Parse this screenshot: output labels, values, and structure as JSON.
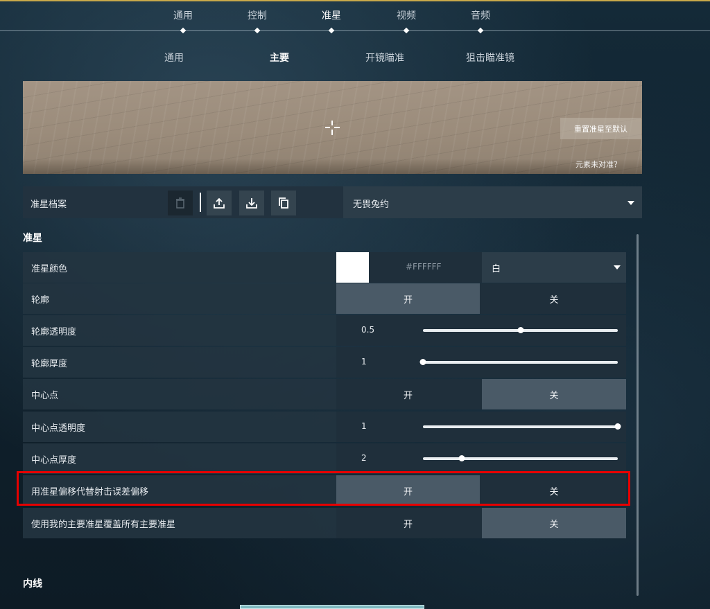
{
  "nav": {
    "tabs": [
      "通用",
      "控制",
      "准星",
      "视频",
      "音频"
    ],
    "active_tab": "准星",
    "subtabs": [
      "通用",
      "主要",
      "开镜瞄准",
      "狙击瞄准镜"
    ],
    "active_subtab": "主要"
  },
  "preview": {
    "reset_label": "重置准星至默认",
    "misaligned_label": "元素未对准？"
  },
  "profile": {
    "label": "准星档案",
    "selected": "无畏兔约",
    "icons": [
      "trash-icon",
      "upload-icon",
      "download-icon",
      "copy-icon"
    ]
  },
  "section_title": "准星",
  "settings": {
    "color": {
      "label": "准星颜色",
      "hex": "#FFFFFF",
      "name": "白",
      "swatch": "#FFFFFF"
    },
    "outline": {
      "label": "轮廓",
      "on": "开",
      "off": "关",
      "selected": "on"
    },
    "outline_opacity": {
      "label": "轮廓透明度",
      "value": "0.5",
      "fraction": 0.5
    },
    "outline_thickness": {
      "label": "轮廓厚度",
      "value": "1",
      "fraction": 0.0
    },
    "center_dot": {
      "label": "中心点",
      "on": "开",
      "off": "关",
      "selected": "off"
    },
    "center_dot_opacity": {
      "label": "中心点透明度",
      "value": "1",
      "fraction": 1.0
    },
    "center_dot_thickness": {
      "label": "中心点厚度",
      "value": "2",
      "fraction": 0.2
    },
    "firing_error_offset": {
      "label": "用准星偏移代替射击误差偏移",
      "on": "开",
      "off": "关",
      "selected": "on"
    },
    "override_primary": {
      "label": "使用我的主要准星覆盖所有主要准星",
      "on": "开",
      "off": "关",
      "selected": "off"
    }
  },
  "inner_lines_title": "内线",
  "colors": {
    "accent": "#c9a94a",
    "highlight": "#e60000"
  }
}
